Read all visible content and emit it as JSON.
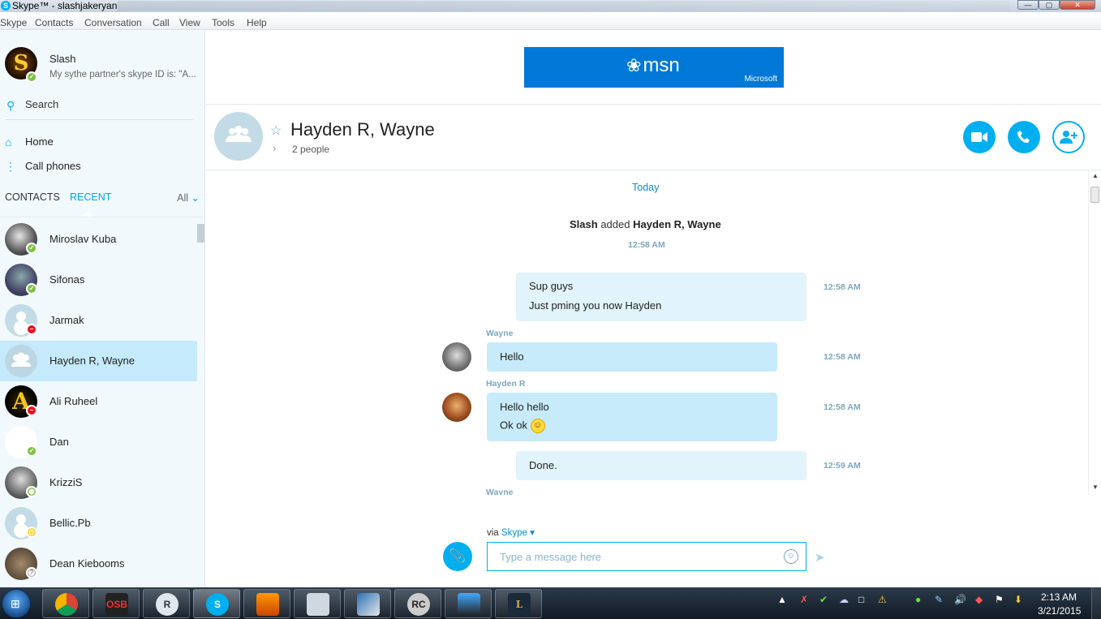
{
  "window": {
    "title": "Skype™ - slashjakeryan",
    "controls": {
      "minimize": "—",
      "maximize": "▢",
      "close": "✕"
    }
  },
  "menu": [
    "Skype",
    "Contacts",
    "Conversation",
    "Call",
    "View",
    "Tools",
    "Help"
  ],
  "profile": {
    "initial": "S",
    "name": "Slash",
    "mood": "My sythe partner's skype ID is: \"A...",
    "status": "online"
  },
  "sidebar": {
    "search_label": "Search",
    "nav": [
      {
        "label": "Home",
        "icon": "home-icon"
      },
      {
        "label": "Call phones",
        "icon": "dialpad-icon"
      }
    ],
    "tabs": {
      "contacts": "CONTACTS",
      "recent": "RECENT",
      "filter": "All"
    },
    "contacts": [
      {
        "name": "Miroslav Kuba",
        "status": "online",
        "avatar": "photo1"
      },
      {
        "name": "Sifonas",
        "status": "online",
        "avatar": "photo2"
      },
      {
        "name": "Jarmak",
        "status": "busy",
        "avatar": "default"
      },
      {
        "name": "Hayden  R, Wayne",
        "status": "none",
        "avatar": "group",
        "selected": true
      },
      {
        "name": "Ali Ruheel",
        "status": "busy",
        "avatar": "ali",
        "initial": "A"
      },
      {
        "name": "Dan",
        "status": "online",
        "avatar": "blank"
      },
      {
        "name": "KrizziS",
        "status": "offline",
        "avatar": "photo3"
      },
      {
        "name": "Bellic.Pb",
        "status": "away",
        "avatar": "default"
      },
      {
        "name": "Dean Kiebooms",
        "status": "unknown",
        "avatar": "photo4"
      }
    ]
  },
  "ad": {
    "logo": "msn",
    "brand": "Microsoft"
  },
  "conversation": {
    "title": "Hayden  R, Wayne",
    "subtitle": "2 people",
    "day_label": "Today",
    "system_message": {
      "actor": "Slash",
      "verb": "added",
      "target": "Hayden  R, Wayne",
      "time": "12:58 AM"
    },
    "messages": [
      {
        "sender": "",
        "mine": true,
        "lines": [
          "Sup guys",
          "Just pming you now Hayden"
        ],
        "time": "12:58 AM"
      },
      {
        "sender": "Wayne",
        "mine": false,
        "lines": [
          "Hello"
        ],
        "time": "12:58 AM"
      },
      {
        "sender": "Hayden  R",
        "mine": false,
        "lines": [
          "Hello hello",
          "Ok ok"
        ],
        "time": "12:58 AM",
        "emoji": "smile"
      },
      {
        "sender": "",
        "mine": true,
        "lines": [
          "Done."
        ],
        "time": "12:59 AM"
      }
    ],
    "next_sender": "Wayne"
  },
  "composer": {
    "via_label": "via",
    "via_service": "Skype",
    "placeholder": "Type a message here"
  },
  "taskbar": {
    "items": [
      {
        "name": "chrome",
        "label": ""
      },
      {
        "name": "osbot",
        "label": "OSB"
      },
      {
        "name": "runescape",
        "label": "R"
      },
      {
        "name": "skype",
        "label": "S"
      },
      {
        "name": "winamp",
        "label": ""
      },
      {
        "name": "calculator",
        "label": ""
      },
      {
        "name": "notepad",
        "label": ""
      },
      {
        "name": "app-rc",
        "label": "RC"
      },
      {
        "name": "hypercam",
        "label": ""
      },
      {
        "name": "league",
        "label": "L"
      }
    ],
    "time": "2:13 AM",
    "date": "3/21/2015"
  },
  "colors": {
    "accent": "#00aff0",
    "selected_row": "#c4eafb",
    "bubble": "#c7ebfa",
    "ad_bg": "#0078d7"
  }
}
